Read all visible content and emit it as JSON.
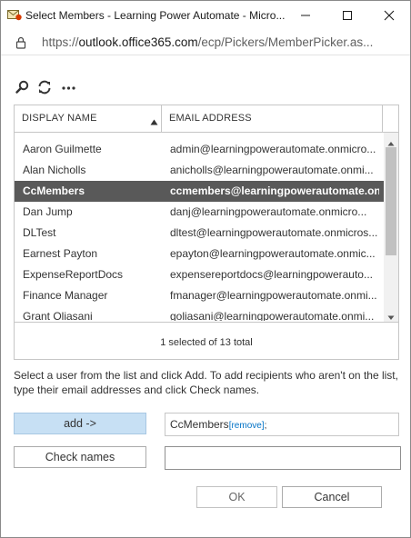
{
  "window": {
    "title": "Select Members - Learning Power Automate - Micro...",
    "url_prefix": "https://",
    "url_domain": "outlook.office365.com",
    "url_path": "/ecp/Pickers/MemberPicker.as..."
  },
  "toolbar": {
    "icons": [
      "search-icon",
      "refresh-icon",
      "more-icon"
    ]
  },
  "grid": {
    "columns": [
      "DISPLAY NAME",
      "EMAIL ADDRESS"
    ],
    "rows": [
      {
        "name": "Aaron Guilmette",
        "email": "admin@learningpowerautomate.onmicro..."
      },
      {
        "name": "Alan Nicholls",
        "email": "anicholls@learningpowerautomate.onmi..."
      },
      {
        "name": "CcMembers",
        "email": "ccmembers@learningpowerautomate.on..."
      },
      {
        "name": "Dan Jump",
        "email": "danj@learningpowerautomate.onmicro..."
      },
      {
        "name": "DLTest",
        "email": "dltest@learningpowerautomate.onmicros..."
      },
      {
        "name": "Earnest Payton",
        "email": "epayton@learningpowerautomate.onmic..."
      },
      {
        "name": "ExpenseReportDocs",
        "email": "expensereportdocs@learningpowerauto..."
      },
      {
        "name": "Finance Manager",
        "email": "fmanager@learningpowerautomate.onmi..."
      },
      {
        "name": "Grant Oliasani",
        "email": "goliasani@learningpowerautomate.onmi..."
      }
    ],
    "selected_index": 2,
    "status": "1 selected of 13 total"
  },
  "instructions": "Select a user from the list and click Add. To add recipients who aren't on the list, type their email addresses and click Check names.",
  "buttons": {
    "add": "add ->",
    "check_names": "Check names",
    "ok": "OK",
    "cancel": "Cancel"
  },
  "recipients": {
    "name": "CcMembers",
    "remove_label": "[remove]",
    "separator": ";"
  },
  "colors": {
    "selected_row": "#595959",
    "add_button": "#c7e0f4",
    "link": "#0072c6"
  }
}
